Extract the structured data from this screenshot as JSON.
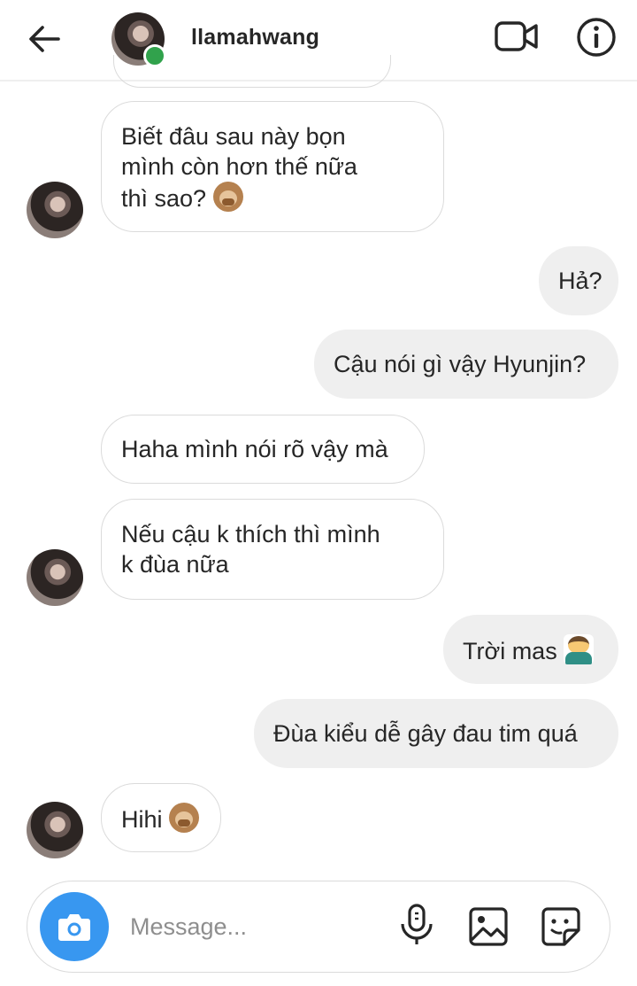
{
  "header": {
    "username": "llamahwang",
    "online": true,
    "icons": [
      "back-arrow-icon",
      "video-camera-icon",
      "info-icon"
    ]
  },
  "messages": [
    {
      "direction": "incoming",
      "text": "Biết đâu sau này bọn mình còn hơn thế nữa thì sao?",
      "emoji": "see-no-evil-monkey",
      "lines": [
        "Biết đâu sau này bọn",
        "mình còn hơn thế nữa",
        "thì sao? "
      ]
    },
    {
      "direction": "outgoing",
      "text": "Hả?"
    },
    {
      "direction": "outgoing",
      "text": "Cậu nói gì vậy Hyunjin?"
    },
    {
      "direction": "incoming",
      "text": "Haha mình nói rõ vậy mà"
    },
    {
      "direction": "incoming",
      "text": "Nếu cậu k thích thì mình k đùa nữa",
      "lines": [
        "Nếu cậu k thích thì mình",
        "k đùa nữa"
      ]
    },
    {
      "direction": "outgoing",
      "text": "Trời mas ",
      "emoji": "man-facepalming"
    },
    {
      "direction": "outgoing",
      "text": "Đùa kiểu dễ gây đau tim quá"
    },
    {
      "direction": "incoming",
      "text": "Hihi ",
      "emoji": "see-no-evil-monkey"
    }
  ],
  "composer": {
    "placeholder": "Message...",
    "icons": [
      "camera-icon",
      "microphone-icon",
      "gallery-icon",
      "sticker-icon"
    ]
  },
  "colors": {
    "accent": "#3897f0",
    "online": "#31a24c",
    "outgoing_bubble": "#efefef",
    "incoming_border": "#dbdbdb"
  }
}
